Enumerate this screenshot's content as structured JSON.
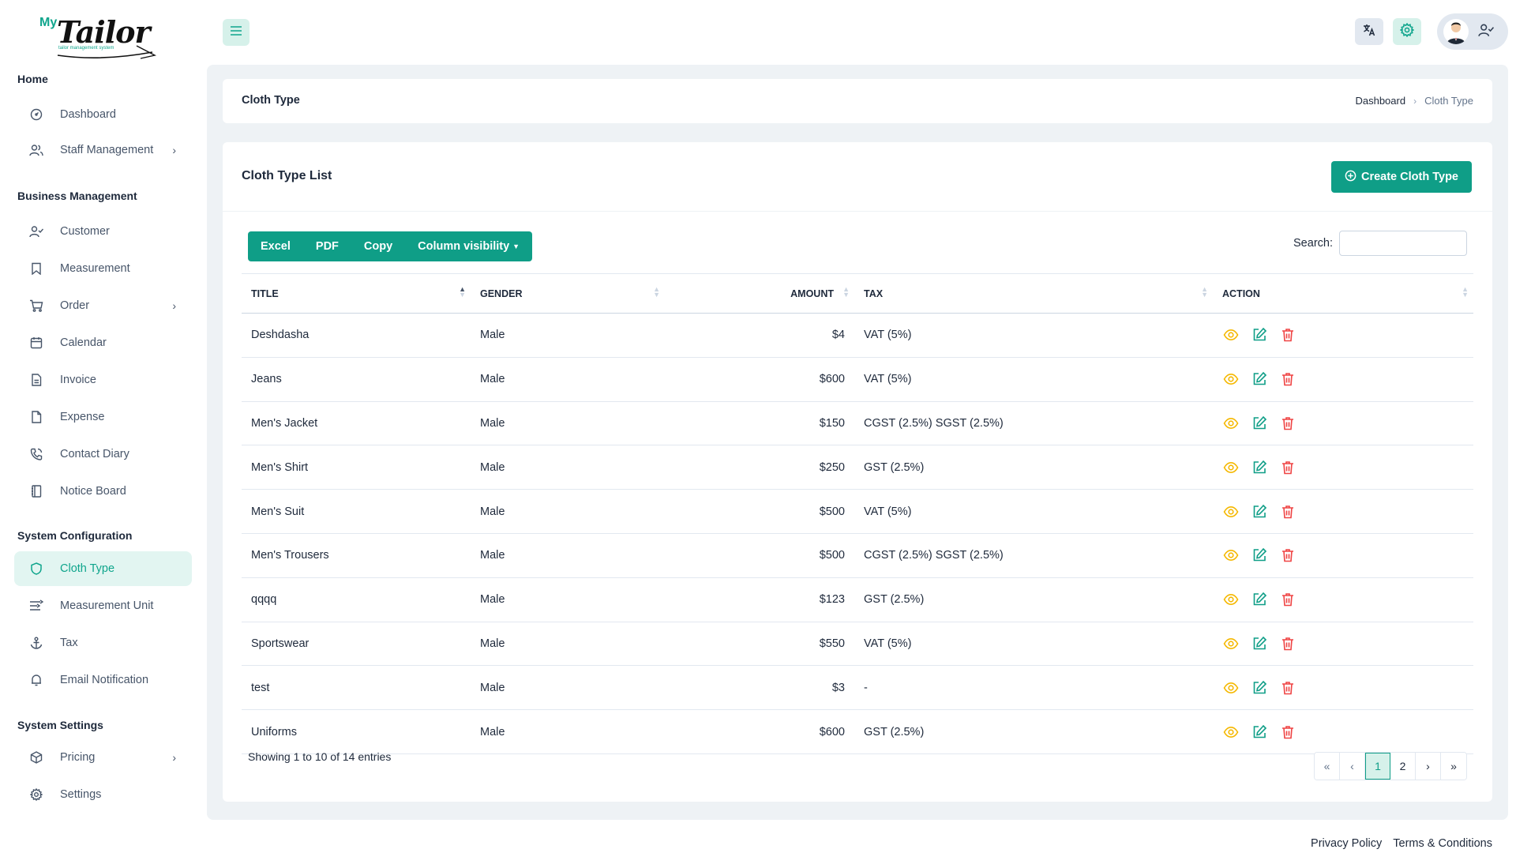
{
  "colors": {
    "accent": "#0f9e87",
    "accent_light": "#d6f1ea",
    "danger": "#ef4444",
    "warning": "#f5b800",
    "content_bg": "#eef2f5"
  },
  "logo": {
    "my": "My",
    "brand": "Tailor",
    "tagline": "tailor management system"
  },
  "sidebar": {
    "sections": {
      "home": "Home",
      "business": "Business Management",
      "system_config": "System Configuration",
      "system_settings": "System Settings"
    },
    "items": {
      "dashboard": "Dashboard",
      "staff": "Staff Management",
      "customer": "Customer",
      "measurement": "Measurement",
      "order": "Order",
      "calendar": "Calendar",
      "invoice": "Invoice",
      "expense": "Expense",
      "contact_diary": "Contact Diary",
      "notice_board": "Notice Board",
      "cloth_type": "Cloth Type",
      "measurement_unit": "Measurement Unit",
      "tax": "Tax",
      "email_notification": "Email Notification",
      "pricing": "Pricing",
      "settings": "Settings"
    }
  },
  "header": {
    "page_title": "Cloth Type"
  },
  "breadcrumb": {
    "home": "Dashboard",
    "current": "Cloth Type"
  },
  "card": {
    "title": "Cloth Type List",
    "create_label": "Create Cloth Type"
  },
  "toolbar": {
    "excel": "Excel",
    "pdf": "PDF",
    "copy": "Copy",
    "column_visibility": "Column visibility"
  },
  "search": {
    "label": "Search:",
    "value": ""
  },
  "table": {
    "columns": {
      "title": "TITLE",
      "gender": "GENDER",
      "amount": "AMOUNT",
      "tax": "TAX",
      "action": "ACTION"
    },
    "rows": [
      {
        "title": "Deshdasha",
        "gender": "Male",
        "amount": "$4",
        "tax": "VAT (5%)"
      },
      {
        "title": "Jeans",
        "gender": "Male",
        "amount": "$600",
        "tax": "VAT (5%)"
      },
      {
        "title": "Men's Jacket",
        "gender": "Male",
        "amount": "$150",
        "tax": "CGST (2.5%) SGST (2.5%)"
      },
      {
        "title": "Men's Shirt",
        "gender": "Male",
        "amount": "$250",
        "tax": "GST (2.5%)"
      },
      {
        "title": "Men's Suit",
        "gender": "Male",
        "amount": "$500",
        "tax": "VAT (5%)"
      },
      {
        "title": "Men's Trousers",
        "gender": "Male",
        "amount": "$500",
        "tax": "CGST (2.5%) SGST (2.5%)"
      },
      {
        "title": "qqqq",
        "gender": "Male",
        "amount": "$123",
        "tax": "GST (2.5%)"
      },
      {
        "title": "Sportswear",
        "gender": "Male",
        "amount": "$550",
        "tax": "VAT (5%)"
      },
      {
        "title": "test",
        "gender": "Male",
        "amount": "$3",
        "tax": "-"
      },
      {
        "title": "Uniforms",
        "gender": "Male",
        "amount": "$600",
        "tax": "GST (2.5%)"
      }
    ]
  },
  "pagination": {
    "info": "Showing 1 to 10 of 14 entries",
    "first": "«",
    "prev": "‹",
    "page1": "1",
    "page2": "2",
    "next": "›",
    "last": "»"
  },
  "footer": {
    "privacy": "Privacy Policy",
    "terms": "Terms & Conditions"
  }
}
